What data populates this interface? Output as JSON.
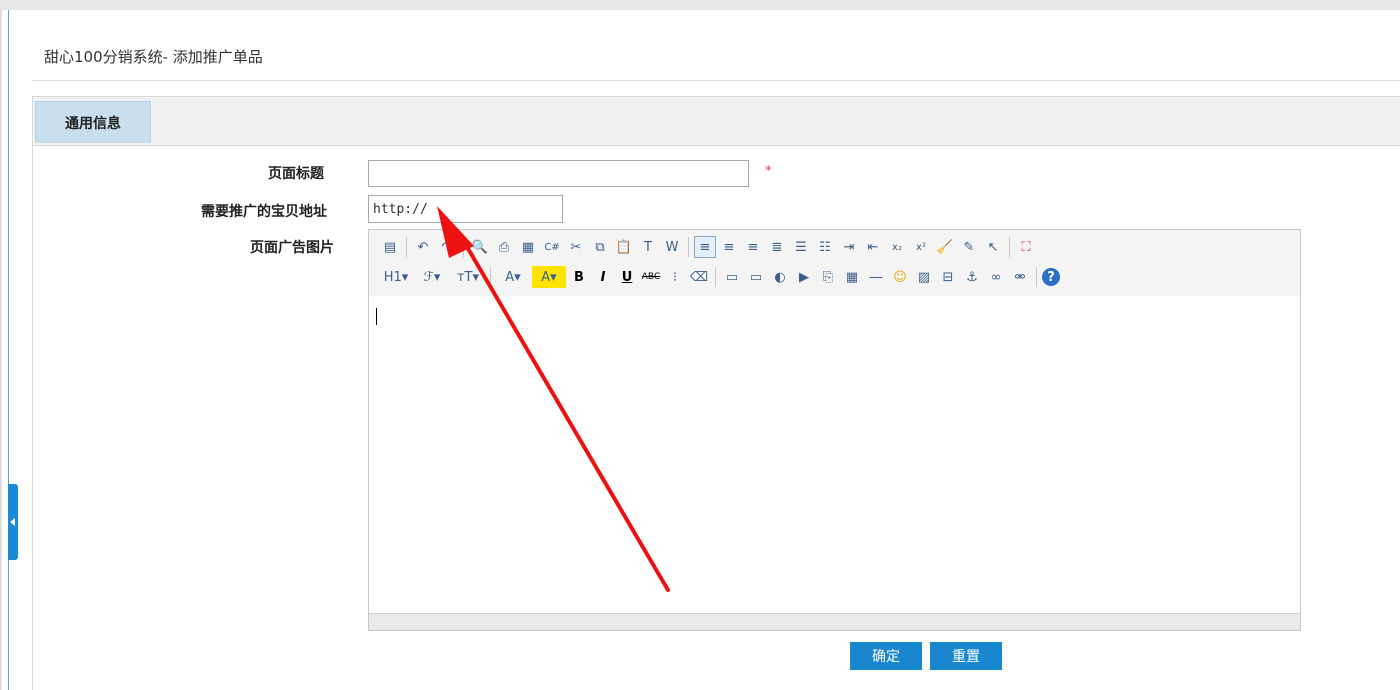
{
  "page": {
    "title": "甜心100分销系统- 添加推广单品"
  },
  "tabs": [
    {
      "label": "通用信息",
      "active": true
    }
  ],
  "form": {
    "page_title_label": "页面标题",
    "page_title_value": "",
    "required_mark": "*",
    "url_label": "需要推广的宝贝地址",
    "url_value": "http://",
    "image_label": "页面广告图片"
  },
  "editor": {
    "row1": [
      {
        "icon": "source-icon",
        "glyph": "▤"
      },
      {
        "sep": true
      },
      {
        "icon": "undo-icon",
        "glyph": "↶"
      },
      {
        "icon": "redo-icon",
        "glyph": "↷"
      },
      {
        "sep": true
      },
      {
        "icon": "preview-icon",
        "glyph": "🔍"
      },
      {
        "icon": "print-icon",
        "glyph": "⎙"
      },
      {
        "icon": "template-icon",
        "glyph": "▦"
      },
      {
        "icon": "code-icon",
        "glyph": "C#"
      },
      {
        "icon": "cut-icon",
        "glyph": "✂"
      },
      {
        "icon": "copy-icon",
        "glyph": "⧉"
      },
      {
        "icon": "paste-icon",
        "glyph": "📋"
      },
      {
        "icon": "paste-text-icon",
        "glyph": "T"
      },
      {
        "icon": "paste-word-icon",
        "glyph": "W"
      },
      {
        "sep": true
      },
      {
        "icon": "align-left-icon",
        "glyph": "≡",
        "active": true
      },
      {
        "icon": "align-center-icon",
        "glyph": "≡"
      },
      {
        "icon": "align-right-icon",
        "glyph": "≡"
      },
      {
        "icon": "align-justify-icon",
        "glyph": "≣"
      },
      {
        "icon": "ordered-list-icon",
        "glyph": "☰"
      },
      {
        "icon": "unordered-list-icon",
        "glyph": "☷"
      },
      {
        "icon": "indent-icon",
        "glyph": "⇥"
      },
      {
        "icon": "outdent-icon",
        "glyph": "⇤"
      },
      {
        "icon": "subscript-icon",
        "glyph": "x₂"
      },
      {
        "icon": "superscript-icon",
        "glyph": "x²"
      },
      {
        "icon": "clear-format-icon",
        "glyph": "🧹"
      },
      {
        "icon": "select-all-icon",
        "glyph": "✎"
      },
      {
        "icon": "pointer-icon",
        "glyph": "↖"
      },
      {
        "sep": true
      },
      {
        "icon": "fullscreen-icon",
        "glyph": "⛶"
      }
    ],
    "row2": [
      {
        "icon": "heading-icon",
        "glyph": "H1▾",
        "wide": true
      },
      {
        "icon": "font-family-icon",
        "glyph": "ℱ▾",
        "wide": true
      },
      {
        "icon": "font-size-icon",
        "glyph": "тT▾",
        "wide": true
      },
      {
        "sep": true
      },
      {
        "icon": "font-color-icon",
        "glyph": "A▾",
        "wide": true
      },
      {
        "icon": "highlight-color-icon",
        "glyph": "A▾",
        "wide": true
      },
      {
        "icon": "bold-icon",
        "glyph": "B"
      },
      {
        "icon": "italic-icon",
        "glyph": "I"
      },
      {
        "icon": "underline-icon",
        "glyph": "U"
      },
      {
        "icon": "strikethrough-icon",
        "glyph": "ABC"
      },
      {
        "icon": "line-height-icon",
        "glyph": "⁝"
      },
      {
        "icon": "eraser-icon",
        "glyph": "⌫"
      },
      {
        "sep": true
      },
      {
        "icon": "insert-image-icon",
        "glyph": "▭"
      },
      {
        "icon": "multi-image-icon",
        "glyph": "▭"
      },
      {
        "icon": "flash-icon",
        "glyph": "◐"
      },
      {
        "icon": "media-icon",
        "glyph": "▶"
      },
      {
        "icon": "attachment-icon",
        "glyph": "⎘"
      },
      {
        "icon": "table-icon",
        "glyph": "▦"
      },
      {
        "icon": "hr-icon",
        "glyph": "―"
      },
      {
        "icon": "emoticon-icon",
        "glyph": "☺"
      },
      {
        "icon": "map-icon",
        "glyph": "▨"
      },
      {
        "icon": "page-break-icon",
        "glyph": "⊟"
      },
      {
        "icon": "anchor-icon",
        "glyph": "⚓"
      },
      {
        "icon": "link-icon",
        "glyph": "∞"
      },
      {
        "icon": "unlink-icon",
        "glyph": "⚮"
      },
      {
        "sep": true
      },
      {
        "icon": "help-icon",
        "glyph": "?"
      }
    ]
  },
  "buttons": {
    "confirm": "确定",
    "reset": "重置"
  },
  "colors": {
    "accent": "#1a86cf",
    "tab_active": "#c9dfee",
    "annotation_arrow": "#ee1111"
  }
}
